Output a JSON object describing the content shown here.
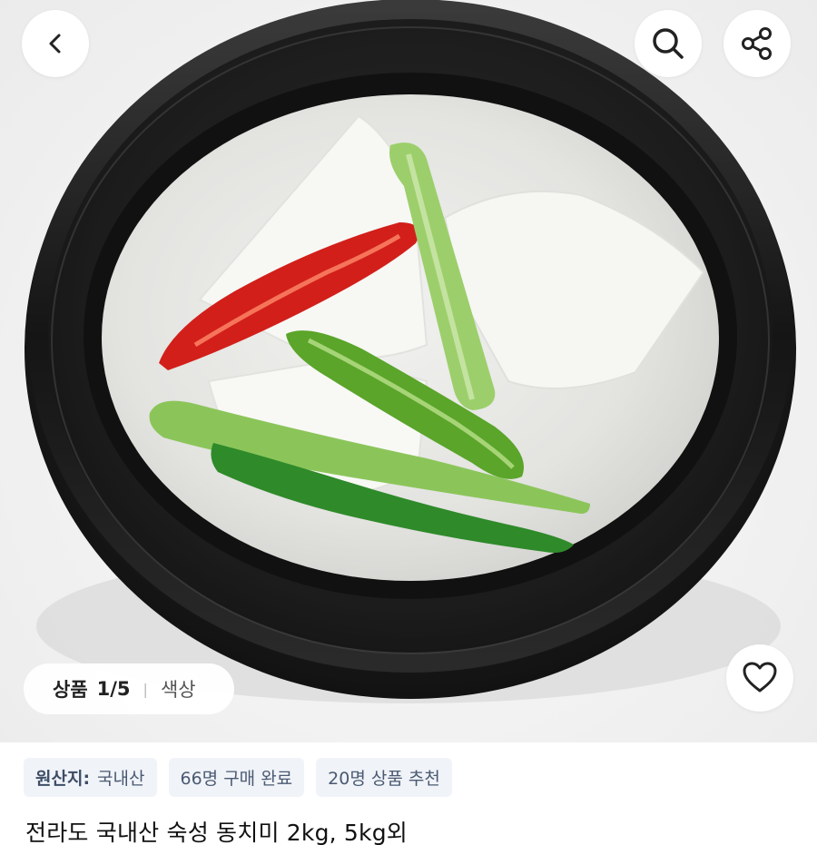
{
  "header": {
    "back_icon": "chevron-left-icon",
    "search_icon": "search-icon",
    "share_icon": "share-icon"
  },
  "gallery": {
    "label": "상품",
    "counter": "1/5",
    "separator": "|",
    "option_label": "색상",
    "like_icon": "heart-outline-icon",
    "image_alt": "동치미 - 흑색 뚝배기에 담긴 무, 홍고추, 청고추, 쪽파"
  },
  "tags": [
    {
      "key": "원산지:",
      "value": "국내산"
    },
    {
      "key": "",
      "value": "66명 구매 완료"
    },
    {
      "key": "",
      "value": "20명 상품 추천"
    }
  ],
  "product": {
    "title": "전라도 국내산 숙성 동치미 2kg, 5kg외"
  },
  "colors": {
    "tag_bg": "#f0f3f8",
    "tag_text": "#4a5a72",
    "pot": "#1a1a1a",
    "broth": "#e8e8e6"
  }
}
